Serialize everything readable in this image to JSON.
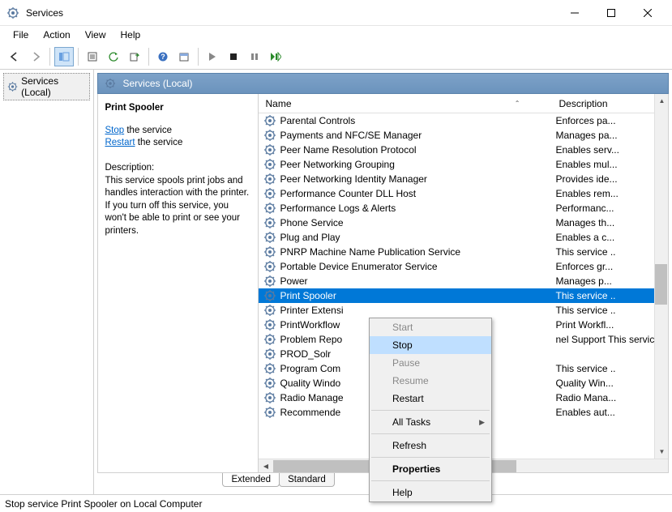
{
  "window": {
    "title": "Services"
  },
  "menubar": [
    "File",
    "Action",
    "View",
    "Help"
  ],
  "tree": {
    "root": "Services (Local)"
  },
  "pane_header": "Services (Local)",
  "detail": {
    "name": "Print Spooler",
    "action_stop": "Stop",
    "action_stop_suffix": " the service",
    "action_restart": "Restart",
    "action_restart_suffix": " the service",
    "desc_label": "Description:",
    "desc_text": "This service spools print jobs and handles interaction with the printer. If you turn off this service, you won't be able to print or see your printers."
  },
  "columns": {
    "name": "Name",
    "description": "Description"
  },
  "services": [
    {
      "name": "Parental Controls",
      "desc": "Enforces pa..."
    },
    {
      "name": "Payments and NFC/SE Manager",
      "desc": "Manages pa..."
    },
    {
      "name": "Peer Name Resolution Protocol",
      "desc": "Enables serv..."
    },
    {
      "name": "Peer Networking Grouping",
      "desc": "Enables mul..."
    },
    {
      "name": "Peer Networking Identity Manager",
      "desc": "Provides ide..."
    },
    {
      "name": "Performance Counter DLL Host",
      "desc": "Enables rem..."
    },
    {
      "name": "Performance Logs & Alerts",
      "desc": "Performanc..."
    },
    {
      "name": "Phone Service",
      "desc": "Manages th..."
    },
    {
      "name": "Plug and Play",
      "desc": "Enables a c..."
    },
    {
      "name": "PNRP Machine Name Publication Service",
      "desc": "This service .."
    },
    {
      "name": "Portable Device Enumerator Service",
      "desc": "Enforces gr..."
    },
    {
      "name": "Power",
      "desc": "Manages p..."
    },
    {
      "name": "Print Spooler",
      "desc": "This service ..",
      "selected": true
    },
    {
      "name": "Printer Extensi",
      "desc": "This service .."
    },
    {
      "name": "PrintWorkflow",
      "desc": "Print Workfl..."
    },
    {
      "name": "Problem Repo",
      "desc_suffix": "nel Support",
      "desc": "This service .."
    },
    {
      "name": "PROD_Solr",
      "desc": ""
    },
    {
      "name": "Program Com",
      "desc": "This service .."
    },
    {
      "name": "Quality Windo",
      "desc": "Quality Win..."
    },
    {
      "name": "Radio Manage",
      "desc": "Radio Mana..."
    },
    {
      "name": "Recommende",
      "desc": "Enables aut..."
    }
  ],
  "tabs": [
    "Extended",
    "Standard"
  ],
  "context_menu": [
    {
      "label": "Start",
      "disabled": true
    },
    {
      "label": "Stop",
      "highlight": true
    },
    {
      "label": "Pause",
      "disabled": true
    },
    {
      "label": "Resume",
      "disabled": true
    },
    {
      "label": "Restart"
    },
    {
      "sep": true
    },
    {
      "label": "All Tasks",
      "submenu": true
    },
    {
      "sep": true
    },
    {
      "label": "Refresh"
    },
    {
      "sep": true
    },
    {
      "label": "Properties",
      "bold": true
    },
    {
      "sep": true
    },
    {
      "label": "Help"
    }
  ],
  "statusbar": "Stop service Print Spooler on Local Computer"
}
